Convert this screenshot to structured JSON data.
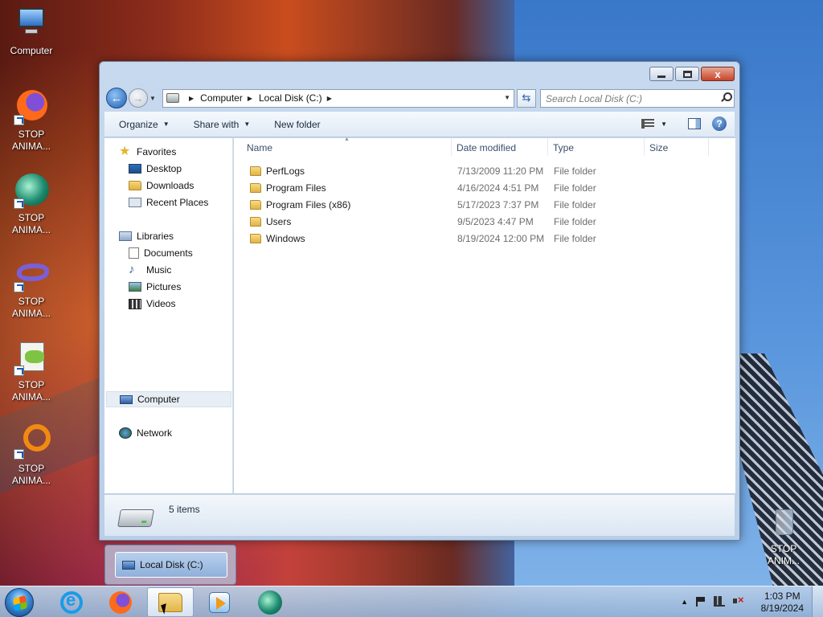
{
  "desktop": {
    "icons": [
      {
        "label": "Computer",
        "icon": "computer-icon"
      },
      {
        "label": "STOP ANIMA...",
        "icon": "firefox-icon"
      },
      {
        "label": "STOP ANIMA...",
        "icon": "mint-app-icon"
      },
      {
        "label": "STOP ANIMA...",
        "icon": "visual-studio-icon"
      },
      {
        "label": "STOP ANIMA...",
        "icon": "notepad-plus-plus-icon"
      },
      {
        "label": "STOP ANIMA...",
        "icon": "orange-ring-icon"
      },
      {
        "label": "STOP ANIM...",
        "icon": "recycle-bin-icon"
      }
    ]
  },
  "window": {
    "controls": {
      "minimize": "minimize",
      "maximize": "maximize",
      "close": "x"
    },
    "address": {
      "crumbs": [
        "Computer",
        "Local Disk (C:)"
      ]
    },
    "search": {
      "placeholder": "Search Local Disk (C:)"
    },
    "commands": {
      "organize": "Organize",
      "share_with": "Share with",
      "new_folder": "New folder"
    },
    "nav": {
      "favorites": "Favorites",
      "desktop": "Desktop",
      "downloads": "Downloads",
      "recent_places": "Recent Places",
      "libraries": "Libraries",
      "documents": "Documents",
      "music": "Music",
      "pictures": "Pictures",
      "videos": "Videos",
      "computer": "Computer",
      "network": "Network"
    },
    "columns": {
      "name": "Name",
      "date_modified": "Date modified",
      "type": "Type",
      "size": "Size"
    },
    "files": [
      {
        "name": "PerfLogs",
        "date": "7/13/2009 11:20 PM",
        "type": "File folder"
      },
      {
        "name": "Program Files",
        "date": "4/16/2024 4:51 PM",
        "type": "File folder"
      },
      {
        "name": "Program Files (x86)",
        "date": "5/17/2023 7:37 PM",
        "type": "File folder"
      },
      {
        "name": "Users",
        "date": "9/5/2023 4:47 PM",
        "type": "File folder"
      },
      {
        "name": "Windows",
        "date": "8/19/2024 12:00 PM",
        "type": "File folder"
      }
    ],
    "status": {
      "items_count": "5 items"
    }
  },
  "taskbar": {
    "preview_label": "Local Disk (C:)",
    "clock_time": "1:03 PM",
    "clock_date": "8/19/2024"
  }
}
